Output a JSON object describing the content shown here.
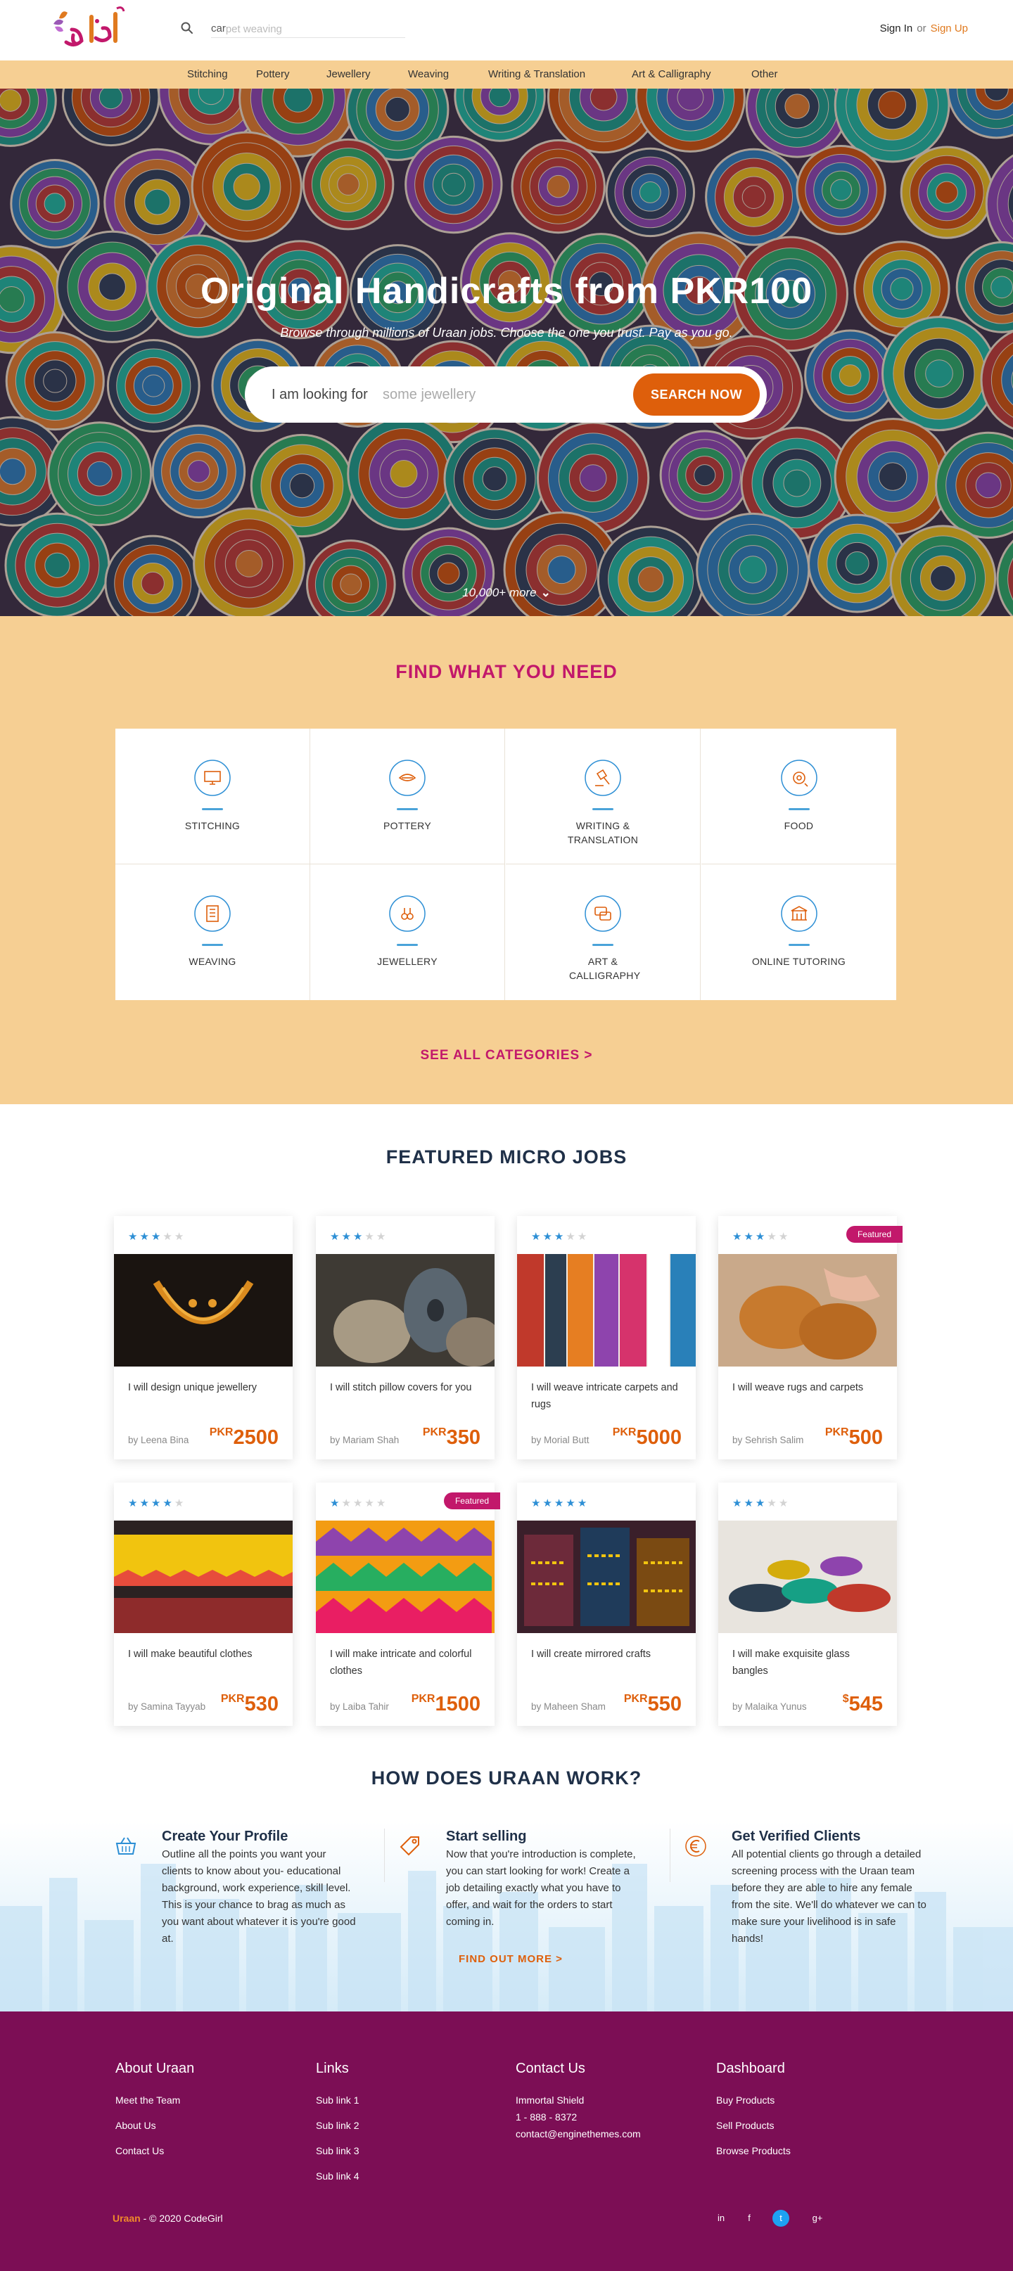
{
  "header": {
    "search_value": "car",
    "search_placeholder": "pet weaving",
    "signin": "Sign In",
    "or": "or",
    "signup": "Sign Up"
  },
  "nav": [
    "Stitching",
    "Pottery",
    "Jewellery",
    "Weaving",
    "Writing & Translation",
    "Art & Calligraphy",
    "Other"
  ],
  "hero": {
    "title": "Original Handicrafts from PKR100",
    "subtitle": "Browse through millions of Uraan jobs. Choose the one you trust. Pay as you go.",
    "prefix": "I am looking for",
    "placeholder": "some jewellery",
    "button": "SEARCH NOW",
    "more": "10,000+ more"
  },
  "categories": {
    "title": "FIND WHAT YOU NEED",
    "items": [
      {
        "label": "STITCHING",
        "icon": "monitor-icon"
      },
      {
        "label": "POTTERY",
        "icon": "pottery-icon"
      },
      {
        "label": "WRITING & TRANSLATION",
        "icon": "gavel-icon"
      },
      {
        "label": "FOOD",
        "icon": "food-icon"
      },
      {
        "label": "WEAVING",
        "icon": "weaving-icon"
      },
      {
        "label": "JEWELLERY",
        "icon": "jewellery-icon"
      },
      {
        "label": "ART & CALLIGRAPHY",
        "icon": "chat-icon"
      },
      {
        "label": "ONLINE TUTORING",
        "icon": "tutoring-icon"
      }
    ],
    "see_all": "SEE ALL CATEGORIES >"
  },
  "jobs": {
    "title": "FEATURED MICRO JOBS",
    "items": [
      {
        "title": "I will design unique jewellery",
        "seller": "Leena Bina",
        "currency": "PKR",
        "price": "2500",
        "rating": 3,
        "featured": false
      },
      {
        "title": "I will stitch pillow covers for you",
        "seller": "Mariam Shah",
        "currency": "PKR",
        "price": "350",
        "rating": 3,
        "featured": false
      },
      {
        "title": "I will weave intricate carpets and rugs",
        "seller": "Morial Butt",
        "currency": "PKR",
        "price": "5000",
        "rating": 3,
        "featured": false
      },
      {
        "title": "I will weave rugs and carpets",
        "seller": "Sehrish Salim",
        "currency": "PKR",
        "price": "500",
        "rating": 3,
        "featured": true
      },
      {
        "title": "I will make beautiful clothes",
        "seller": "Samina Tayyab",
        "currency": "PKR",
        "price": "530",
        "rating": 4,
        "featured": false
      },
      {
        "title": "I will make intricate and colorful clothes",
        "seller": "Laiba Tahir",
        "currency": "PKR",
        "price": "1500",
        "rating": 1,
        "featured": true
      },
      {
        "title": "I will create mirrored crafts",
        "seller": "Maheen Sham",
        "currency": "PKR",
        "price": "550",
        "rating": 5,
        "featured": false
      },
      {
        "title": "I will make exquisite glass bangles",
        "seller": "Malaika Yunus",
        "currency": "$",
        "price": "545",
        "rating": 3,
        "featured": false
      }
    ],
    "by_prefix": "by",
    "featured_label": "Featured"
  },
  "how": {
    "title": "HOW DOES URAAN WORK?",
    "steps": [
      {
        "title": "Create Your Profile",
        "text": "Outline all the points you want your clients to know about you- educational background, work experience, skill level. This is your chance to brag as much as you want about whatever it is you're good at.",
        "icon": "basket-icon"
      },
      {
        "title": "Start selling",
        "text": "Now that you're introduction is complete, you can start looking for work! Create a job detailing exactly what you have to offer, and wait for the orders to start coming in.",
        "icon": "tag-icon"
      },
      {
        "title": "Get Verified Clients",
        "text": "All potential clients go through a detailed screening process with the Uraan team before they are able to hire any female from the site. We'll do whatever we can to make sure your livelihood is in safe hands!",
        "icon": "euro-icon"
      }
    ],
    "find_out": "FIND OUT MORE >"
  },
  "footer": {
    "about": {
      "title": "About Uraan",
      "links": [
        "Meet the Team",
        "About Us",
        "Contact Us"
      ]
    },
    "links": {
      "title": "Links",
      "links": [
        "Sub link 1",
        "Sub link 2",
        "Sub link 3",
        "Sub link 4"
      ]
    },
    "contact": {
      "title": "Contact Us",
      "lines": [
        "Immortal Shield",
        "1 - 888 - 8372",
        "contact@enginethemes.com"
      ]
    },
    "dashboard": {
      "title": "Dashboard",
      "links": [
        "Buy Products",
        "Sell Products",
        "Browse Products"
      ]
    },
    "brand": "Uraan",
    "copyright": " - © 2020 CodeGirl",
    "social": [
      "in",
      "f",
      "t",
      "g+"
    ]
  },
  "colors": {
    "accent_orange": "#de5f0b",
    "accent_magenta": "#c2186b",
    "peach": "#f6cf93",
    "footer_purple": "#7c0e55",
    "star_blue": "#2d8fd5"
  }
}
